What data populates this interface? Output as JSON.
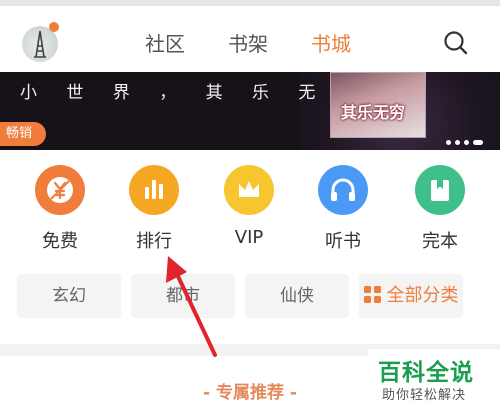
{
  "header": {
    "tabs": [
      {
        "label": "社区",
        "active": false
      },
      {
        "label": "书架",
        "active": false
      },
      {
        "label": "书城",
        "active": true
      }
    ],
    "search_icon": "search-icon"
  },
  "banner": {
    "text": "小 世 界 ， 其 乐 无 穷",
    "cover_text": "其乐无穷",
    "badge": "畅销"
  },
  "quick_links": [
    {
      "label": "免费",
      "icon": "free-icon",
      "color": "#f07d3c"
    },
    {
      "label": "排行",
      "icon": "ranking-icon",
      "color": "#f5a623"
    },
    {
      "label": "VIP",
      "icon": "crown-icon",
      "color": "#f7c62f"
    },
    {
      "label": "听书",
      "icon": "headphones-icon",
      "color": "#4a9af5"
    },
    {
      "label": "完本",
      "icon": "bookmark-icon",
      "color": "#3fbf8a"
    }
  ],
  "categories": [
    "玄幻",
    "都市",
    "仙侠",
    "全部分类"
  ],
  "section": {
    "title": "- 专属推荐 -"
  },
  "watermark": {
    "title": "百科全说",
    "subtitle": "助你轻松解决"
  },
  "colors": {
    "accent": "#f07d3c",
    "watermark_green": "#1a9e4f",
    "arrow": "#e0242b"
  }
}
